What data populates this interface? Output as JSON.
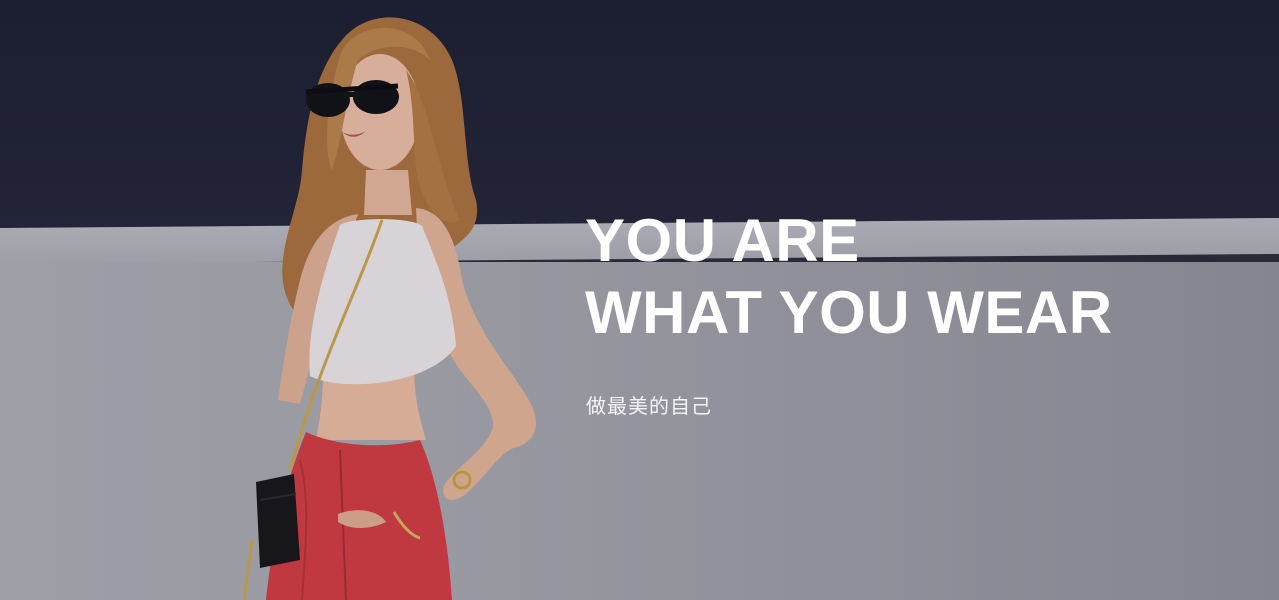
{
  "hero": {
    "headline_line1": "YOU ARE",
    "headline_line2": "WHAT YOU WEAR",
    "subtitle": "做最美的自己",
    "image_alt": "model-photo"
  },
  "colors": {
    "wall_dark": "#1d1f33",
    "wall_light": "#a4a4ad",
    "top_white": "#e9e6e8",
    "pants_red": "#c8313a",
    "hair": "#b07a45",
    "text": "#ffffff"
  }
}
